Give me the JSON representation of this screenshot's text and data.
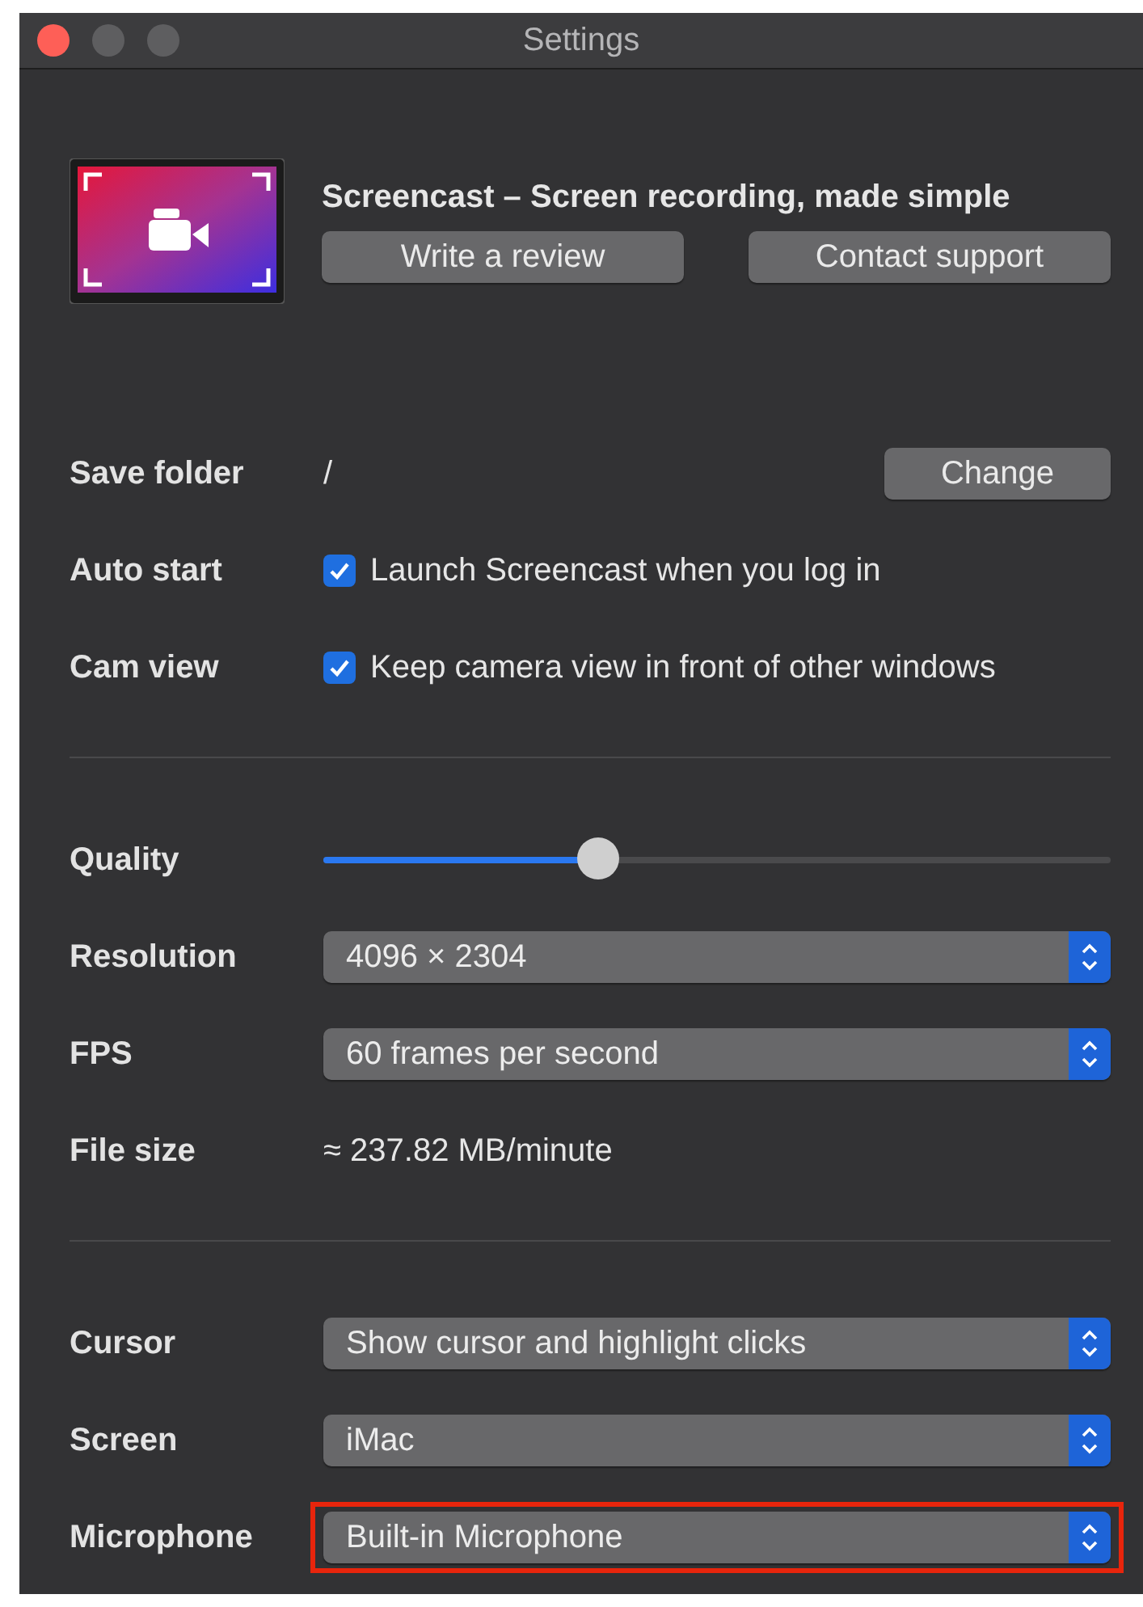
{
  "window": {
    "title": "Settings",
    "traffic_lights": [
      {
        "color": "#fe5f57"
      },
      {
        "color": "#5e5e60"
      },
      {
        "color": "#5e5e60"
      }
    ]
  },
  "header": {
    "title": "Screencast – Screen recording, made simple",
    "buttons": [
      "Write a review",
      "Contact support"
    ]
  },
  "sections": [
    {
      "rows": [
        {
          "kind": "path",
          "label": "Save folder",
          "value": "/",
          "button": "Change"
        },
        {
          "kind": "checkbox",
          "label": "Auto start",
          "text": "Launch Screencast when you log in",
          "checked": true
        },
        {
          "kind": "checkbox",
          "label": "Cam view",
          "text": "Keep camera view in front of other windows",
          "checked": true
        }
      ]
    },
    {
      "rows": [
        {
          "kind": "slider",
          "label": "Quality",
          "level": 0.35
        },
        {
          "kind": "popup",
          "label": "Resolution",
          "value": "4096 × 2304",
          "highlighted": false
        },
        {
          "kind": "popup",
          "label": "FPS",
          "value": "60 frames per second",
          "highlighted": false
        },
        {
          "kind": "text",
          "label": "File size",
          "value": "≈ 237.82 MB/minute"
        }
      ]
    },
    {
      "rows": [
        {
          "kind": "popup",
          "label": "Cursor",
          "value": "Show cursor and highlight clicks",
          "highlighted": false
        },
        {
          "kind": "popup",
          "label": "Screen",
          "value": "iMac",
          "highlighted": false
        },
        {
          "kind": "popup",
          "label": "Microphone",
          "value": "Built-in Microphone",
          "highlighted": true
        }
      ]
    }
  ]
}
